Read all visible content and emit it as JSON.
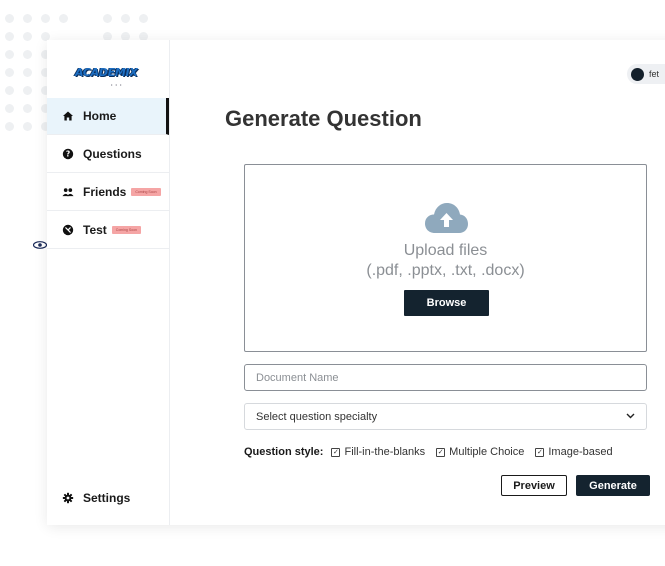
{
  "sidebar": {
    "logo_text": "ACADEMIX",
    "items": [
      {
        "label": "Home",
        "icon": "home-icon"
      },
      {
        "label": "Questions",
        "icon": "question-circle-icon"
      },
      {
        "label": "Friends",
        "icon": "people-icon",
        "badge": "Coming Soon"
      },
      {
        "label": "Test",
        "icon": "test-icon",
        "badge": "Coming Soon"
      }
    ],
    "settings": {
      "label": "Settings",
      "icon": "gear-icon"
    }
  },
  "toggle": {
    "label": "fet"
  },
  "main": {
    "title": "Generate Question",
    "upload": {
      "title": "Upload files",
      "types": "(.pdf, .pptx, .txt, .docx)",
      "browse_label": "Browse",
      "icon": "cloud-upload-icon"
    },
    "document_name": {
      "placeholder": "Document Name",
      "value": ""
    },
    "specialty": {
      "selected": "Select question specialty"
    },
    "question_style": {
      "label": "Question style:",
      "options": [
        {
          "label": "Fill-in-the-blanks",
          "checked": true
        },
        {
          "label": "Multiple Choice",
          "checked": true
        },
        {
          "label": "Image-based",
          "checked": true
        }
      ]
    },
    "preview_label": "Preview",
    "generate_label": "Generate"
  },
  "colors": {
    "primary": "#14232f",
    "active_nav_bg": "#e9f4fb",
    "badge": "#f5a5a5",
    "upload_icon": "#8fa9bd"
  }
}
